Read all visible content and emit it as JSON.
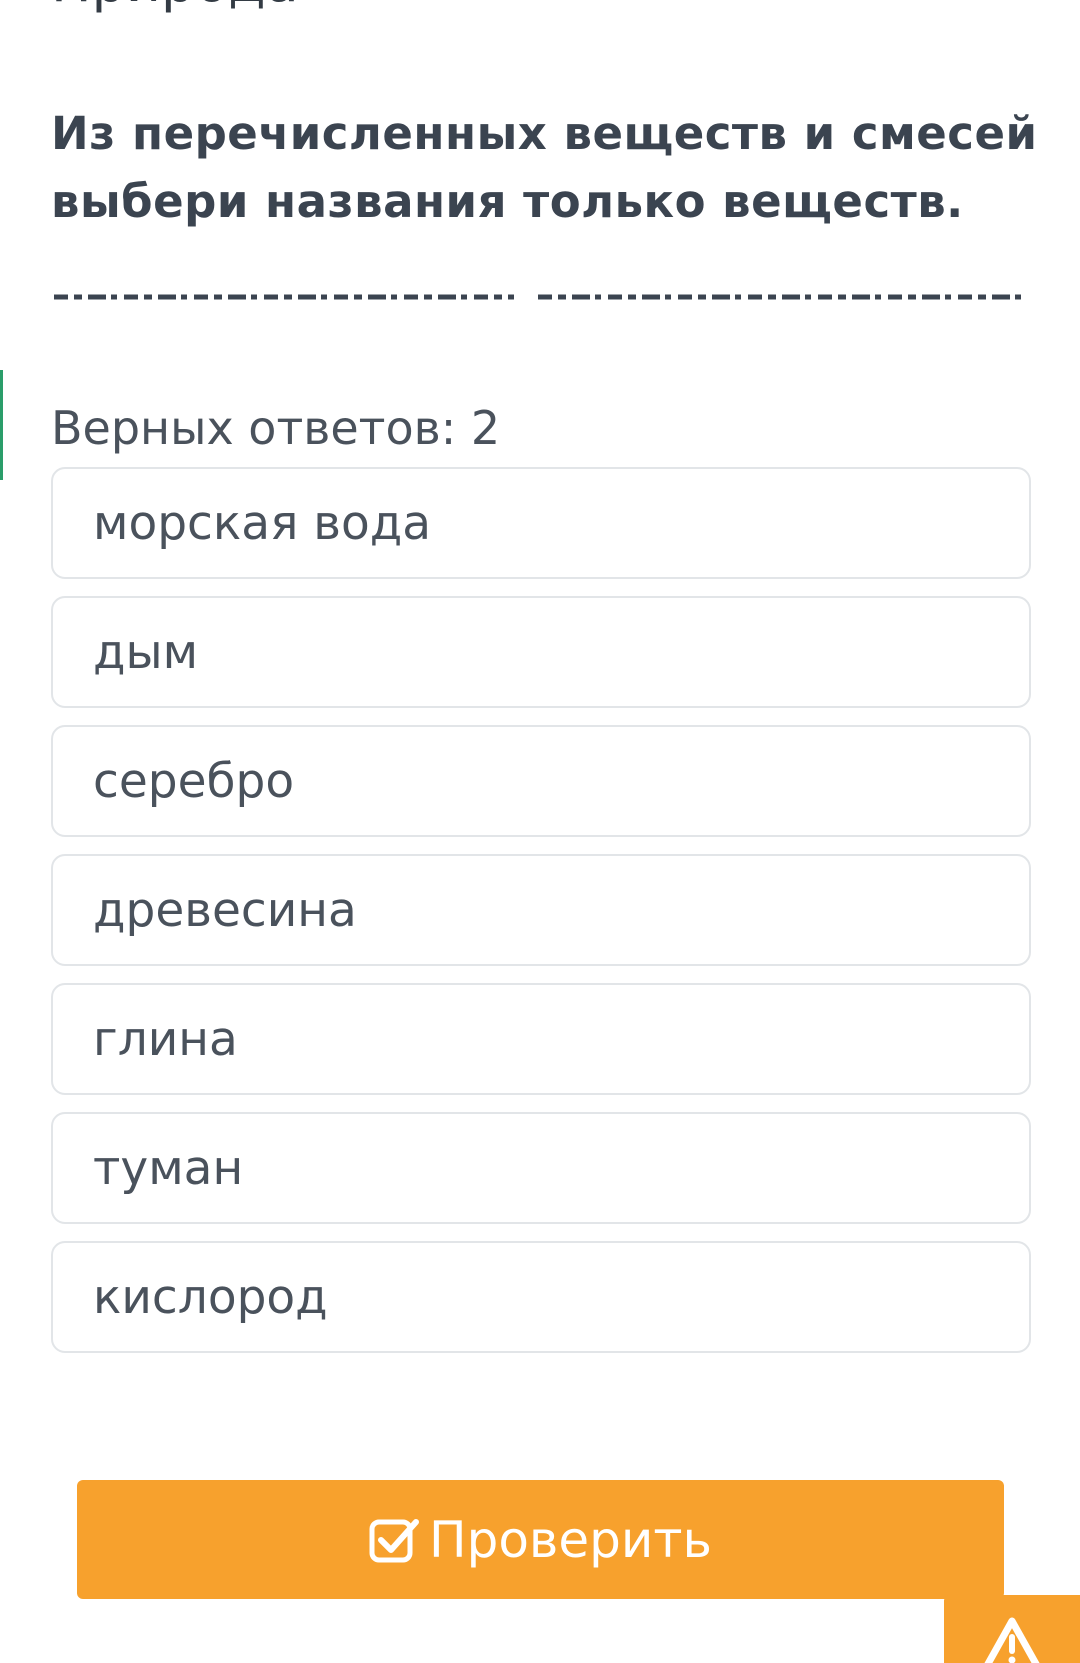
{
  "header": {
    "partial_title": "Природа"
  },
  "question": {
    "text": "Из перечисленных веществ и смесей выбери названия только веществ.",
    "hint": "Верных ответов: 2"
  },
  "options": [
    "морская вода",
    "дым",
    "серебро",
    "древесина",
    "глина",
    "туман",
    "кислород"
  ],
  "actions": {
    "check_label": "Проверить",
    "check_icon": "checkbox-check-icon",
    "report_icon": "warning-icon"
  },
  "colors": {
    "accent_orange": "#f7a12d",
    "text_dark": "#3b4450",
    "border": "#e2e5e8",
    "accent_green": "#2a9d6a"
  }
}
